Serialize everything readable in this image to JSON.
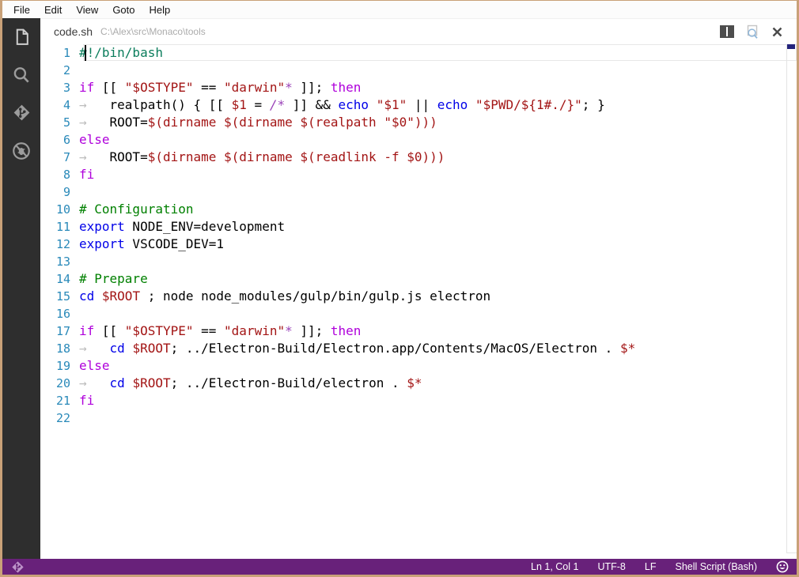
{
  "window": {
    "border_color": "#C9A178",
    "title": "code.sh"
  },
  "menu": {
    "items": [
      "File",
      "Edit",
      "View",
      "Goto",
      "Help"
    ]
  },
  "activity_bar": {
    "icons": [
      "explorer",
      "search",
      "git",
      "debug"
    ]
  },
  "title_bar": {
    "filename": "code.sh",
    "path": "C:\\Alex\\src\\Monaco\\tools",
    "actions": [
      "split-editor",
      "open-preview",
      "close"
    ]
  },
  "editor": {
    "tab_indicator": "→",
    "cursor": {
      "line": 1,
      "col": 1
    },
    "lines": [
      {
        "n": 1,
        "tokens": [
          [
            "sh",
            "#!/bin/bash"
          ]
        ]
      },
      {
        "n": 2,
        "tokens": []
      },
      {
        "n": 3,
        "tokens": [
          [
            "k",
            "if"
          ],
          [
            "d",
            " [[ "
          ],
          [
            "s",
            "\"$OSTYPE\""
          ],
          [
            "d",
            " == "
          ],
          [
            "s",
            "\"darwin\""
          ],
          [
            "g",
            "*"
          ],
          [
            "d",
            " ]]; "
          ],
          [
            "k",
            "then"
          ]
        ]
      },
      {
        "n": 4,
        "tokens": [
          [
            "w",
            "→"
          ],
          [
            "d",
            "realpath() { [[ "
          ],
          [
            "s",
            "$1"
          ],
          [
            "d",
            " = "
          ],
          [
            "g",
            "/*"
          ],
          [
            "d",
            " ]] && "
          ],
          [
            "b",
            "echo"
          ],
          [
            "d",
            " "
          ],
          [
            "s",
            "\"$1\""
          ],
          [
            "d",
            " || "
          ],
          [
            "b",
            "echo"
          ],
          [
            "d",
            " "
          ],
          [
            "s",
            "\"$PWD/${1#./}\""
          ],
          [
            "d",
            "; }"
          ]
        ]
      },
      {
        "n": 5,
        "tokens": [
          [
            "w",
            "→"
          ],
          [
            "d",
            "ROOT="
          ],
          [
            "s",
            "$(dirname $(dirname $(realpath \"$0\")))"
          ]
        ]
      },
      {
        "n": 6,
        "tokens": [
          [
            "k",
            "else"
          ]
        ]
      },
      {
        "n": 7,
        "tokens": [
          [
            "w",
            "→"
          ],
          [
            "d",
            "ROOT="
          ],
          [
            "s",
            "$(dirname $(dirname $(readlink -f $0)))"
          ]
        ]
      },
      {
        "n": 8,
        "tokens": [
          [
            "k",
            "fi"
          ]
        ]
      },
      {
        "n": 9,
        "tokens": []
      },
      {
        "n": 10,
        "tokens": [
          [
            "c",
            "# Configuration"
          ]
        ]
      },
      {
        "n": 11,
        "tokens": [
          [
            "b",
            "export"
          ],
          [
            "d",
            " NODE_ENV=development"
          ]
        ]
      },
      {
        "n": 12,
        "tokens": [
          [
            "b",
            "export"
          ],
          [
            "d",
            " VSCODE_DEV=1"
          ]
        ]
      },
      {
        "n": 13,
        "tokens": []
      },
      {
        "n": 14,
        "tokens": [
          [
            "c",
            "# Prepare"
          ]
        ]
      },
      {
        "n": 15,
        "tokens": [
          [
            "b",
            "cd"
          ],
          [
            "d",
            " "
          ],
          [
            "s",
            "$ROOT"
          ],
          [
            "d",
            " ; node node_modules/gulp/bin/gulp.js electron"
          ]
        ]
      },
      {
        "n": 16,
        "tokens": []
      },
      {
        "n": 17,
        "tokens": [
          [
            "k",
            "if"
          ],
          [
            "d",
            " [[ "
          ],
          [
            "s",
            "\"$OSTYPE\""
          ],
          [
            "d",
            " == "
          ],
          [
            "s",
            "\"darwin\""
          ],
          [
            "g",
            "*"
          ],
          [
            "d",
            " ]]; "
          ],
          [
            "k",
            "then"
          ]
        ]
      },
      {
        "n": 18,
        "tokens": [
          [
            "w",
            "→"
          ],
          [
            "b",
            "cd"
          ],
          [
            "d",
            " "
          ],
          [
            "s",
            "$ROOT"
          ],
          [
            "d",
            "; ../Electron-Build/Electron.app/Contents/MacOS/Electron . "
          ],
          [
            "s",
            "$*"
          ]
        ]
      },
      {
        "n": 19,
        "tokens": [
          [
            "k",
            "else"
          ]
        ]
      },
      {
        "n": 20,
        "tokens": [
          [
            "w",
            "→"
          ],
          [
            "b",
            "cd"
          ],
          [
            "d",
            " "
          ],
          [
            "s",
            "$ROOT"
          ],
          [
            "d",
            "; ../Electron-Build/electron . "
          ],
          [
            "s",
            "$*"
          ]
        ]
      },
      {
        "n": 21,
        "tokens": [
          [
            "k",
            "fi"
          ]
        ]
      },
      {
        "n": 22,
        "tokens": []
      }
    ]
  },
  "status_bar": {
    "background": "#68217A",
    "line_col": "Ln 1, Col 1",
    "encoding": "UTF-8",
    "eol": "LF",
    "language": "Shell Script (Bash)"
  },
  "syntax_colors": {
    "k": "#AF00DB",
    "s": "#A31515",
    "b": "#0000E8",
    "c": "#008000",
    "sh": "#0B7D5C",
    "g": "#9A42B8",
    "d": "#000000",
    "w": "#BDBDBD",
    "line_number": "#2989B9"
  }
}
